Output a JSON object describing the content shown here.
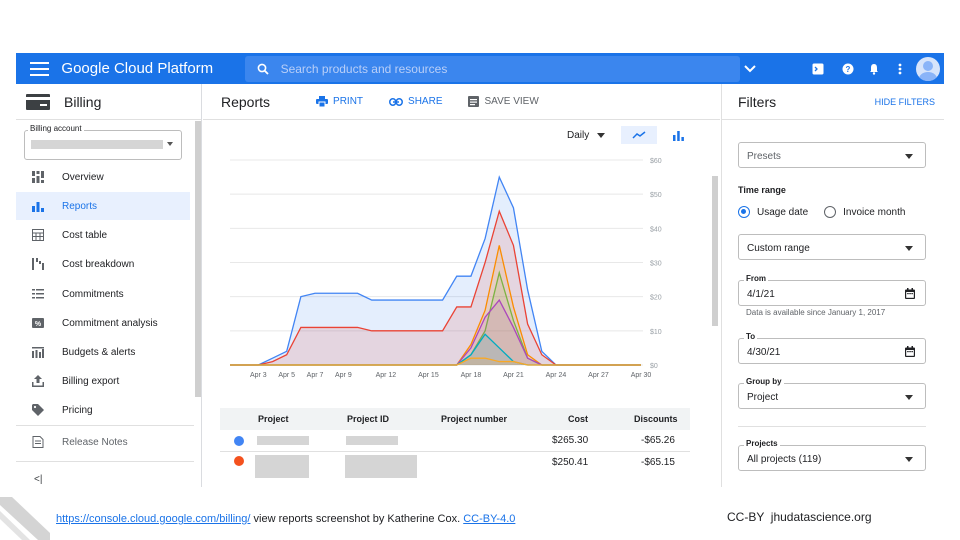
{
  "header": {
    "brand": "Google Cloud Platform",
    "search_placeholder": "Search products and resources"
  },
  "sidebar": {
    "title": "Billing",
    "account_label": "Billing account",
    "items": [
      {
        "label": "Overview",
        "icon": "overview-icon"
      },
      {
        "label": "Reports",
        "icon": "bar-chart-icon",
        "active": true
      },
      {
        "label": "Cost table",
        "icon": "table-icon"
      },
      {
        "label": "Cost breakdown",
        "icon": "breakdown-icon"
      },
      {
        "label": "Commitments",
        "icon": "list-icon"
      },
      {
        "label": "Commitment analysis",
        "icon": "percent-icon"
      },
      {
        "label": "Budgets & alerts",
        "icon": "budget-icon"
      },
      {
        "label": "Billing export",
        "icon": "upload-icon"
      },
      {
        "label": "Pricing",
        "icon": "tag-icon"
      },
      {
        "label": "Release Notes",
        "icon": "notes-icon"
      }
    ]
  },
  "main": {
    "title": "Reports",
    "actions": {
      "print": "PRINT",
      "share": "SHARE",
      "save_view": "SAVE VIEW"
    },
    "granularity": "Daily",
    "table": {
      "headers": [
        "Project",
        "Project ID",
        "Project number",
        "Cost",
        "Discounts"
      ],
      "rows": [
        {
          "cost": "$265.30",
          "discounts": "-$65.26",
          "color": "#4285f4"
        },
        {
          "cost": "$250.41",
          "discounts": "-$65.15",
          "color": "#f4511e"
        }
      ]
    }
  },
  "chart_data": {
    "type": "area",
    "title": "",
    "xlabel": "",
    "ylabel": "",
    "ylim": [
      0,
      60
    ],
    "yticks": [
      "$0",
      "$10",
      "$20",
      "$30",
      "$40",
      "$50",
      "$60"
    ],
    "xtick_labels": [
      "Apr 3",
      "Apr 5",
      "Apr 7",
      "Apr 9",
      "Apr 12",
      "Apr 15",
      "Apr 18",
      "Apr 21",
      "Apr 24",
      "Apr 27",
      "Apr 30"
    ],
    "x": [
      "Apr 1",
      "Apr 2",
      "Apr 3",
      "Apr 4",
      "Apr 5",
      "Apr 6",
      "Apr 7",
      "Apr 8",
      "Apr 9",
      "Apr 10",
      "Apr 11",
      "Apr 12",
      "Apr 13",
      "Apr 14",
      "Apr 15",
      "Apr 16",
      "Apr 17",
      "Apr 18",
      "Apr 19",
      "Apr 20",
      "Apr 21",
      "Apr 22",
      "Apr 23",
      "Apr 24",
      "Apr 25",
      "Apr 26",
      "Apr 27",
      "Apr 28",
      "Apr 29",
      "Apr 30"
    ],
    "series": [
      {
        "color": "#4285f4",
        "values": [
          0,
          0,
          0,
          2,
          4,
          20,
          21,
          21,
          21,
          21,
          19,
          19,
          19,
          19,
          19,
          19,
          26,
          26,
          37,
          55,
          46,
          22,
          4,
          0,
          0,
          0,
          0,
          0,
          0,
          0
        ]
      },
      {
        "color": "#ea4335",
        "values": [
          0,
          0,
          0,
          1,
          3,
          11,
          11,
          11,
          11,
          11,
          10,
          10,
          10,
          10,
          10,
          10,
          17,
          17,
          30,
          45,
          35,
          12,
          3,
          0,
          0,
          0,
          0,
          0,
          0,
          0
        ]
      },
      {
        "color": "#fb8c00",
        "values": [
          0,
          0,
          0,
          0,
          0,
          0,
          0,
          0,
          0,
          0,
          0,
          0,
          0,
          0,
          0,
          0,
          0,
          6,
          16,
          35,
          17,
          3,
          0,
          0,
          0,
          0,
          0,
          0,
          0,
          0
        ]
      },
      {
        "color": "#7cb342",
        "values": [
          0,
          0,
          0,
          0,
          0,
          0,
          0,
          0,
          0,
          0,
          0,
          0,
          0,
          0,
          0,
          0,
          0,
          3,
          10,
          27,
          13,
          2,
          0,
          0,
          0,
          0,
          0,
          0,
          0,
          0
        ]
      },
      {
        "color": "#ab47bc",
        "values": [
          0,
          0,
          0,
          0,
          0,
          0,
          0,
          0,
          0,
          0,
          0,
          0,
          0,
          0,
          0,
          0,
          0,
          5,
          14,
          19,
          11,
          2,
          0,
          0,
          0,
          0,
          0,
          0,
          0,
          0
        ]
      },
      {
        "color": "#00acc1",
        "values": [
          0,
          0,
          0,
          0,
          0,
          0,
          0,
          0,
          0,
          0,
          0,
          0,
          0,
          0,
          0,
          0,
          0,
          3,
          9,
          5,
          1,
          0,
          0,
          0,
          0,
          0,
          0,
          0,
          0,
          0
        ]
      },
      {
        "color": "#f9a825",
        "values": [
          0,
          0,
          0,
          0,
          0,
          0,
          0,
          0,
          0,
          0,
          0,
          0,
          0,
          0,
          0,
          0,
          0,
          2,
          2,
          1,
          1,
          0,
          0,
          0,
          0,
          0,
          0,
          0,
          0,
          0
        ]
      }
    ],
    "grid": true
  },
  "filters": {
    "title": "Filters",
    "hide_label": "HIDE FILTERS",
    "presets": "Presets",
    "time_range_label": "Time range",
    "radio_usage": "Usage date",
    "radio_invoice": "Invoice month",
    "range_select": "Custom range",
    "from_label": "From",
    "from_value": "4/1/21",
    "data_note": "Data is available since January 1, 2017",
    "to_label": "To",
    "to_value": "4/30/21",
    "group_by_label": "Group by",
    "group_by_value": "Project",
    "projects_label": "Projects",
    "projects_value": "All projects (119)"
  },
  "footer": {
    "url": "https://console.cloud.google.com/billing/",
    "credit_text": " view reports screenshot by Katherine Cox. ",
    "license": "CC-BY-4.0",
    "cc_text": "CC-BY  jhudatascience.org"
  }
}
